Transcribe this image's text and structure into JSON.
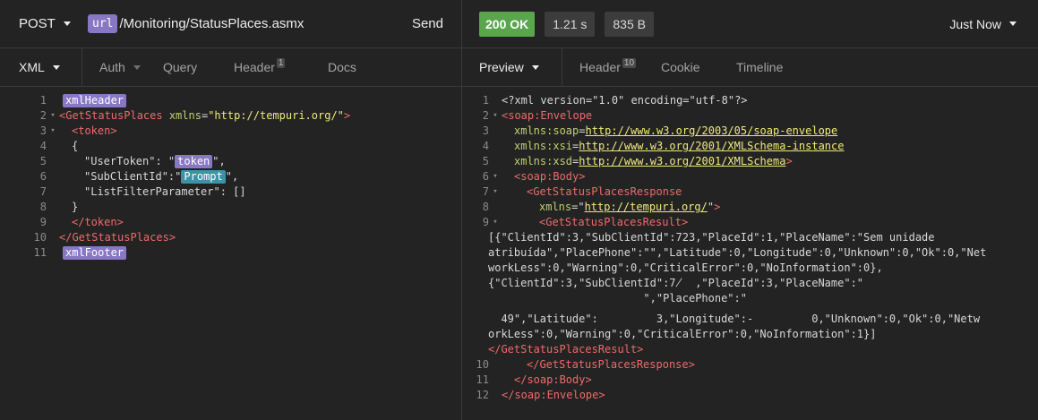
{
  "request": {
    "method": "POST",
    "url_tag": "url",
    "url_path": "/Monitoring/StatusPlaces.asmx",
    "send_label": "Send",
    "tabs": [
      {
        "label": "XML",
        "badge": ""
      },
      {
        "label": "Auth",
        "badge": ""
      },
      {
        "label": "Query",
        "badge": ""
      },
      {
        "label": "Header",
        "badge": "1"
      },
      {
        "label": "Docs",
        "badge": ""
      }
    ],
    "body_lines": {
      "l1_tag": "xmlHeader",
      "l2_open": "<GetStatusPlaces",
      "l2_attr": "xmlns",
      "l2_eq": "=",
      "l2_val": "\"http://tempuri.org/\"",
      "l2_close": ">",
      "l3": "<token>",
      "l4": "{",
      "l5_pre": "\"UserToken\": \"",
      "l5_tag": "token",
      "l5_post": "\",",
      "l6_pre": "\"SubClientId\":\"",
      "l6_tag": "Prompt",
      "l6_post": "\",",
      "l7": "\"ListFilterParameter\": []",
      "l8": "}",
      "l9": "</token>",
      "l10": "</GetStatusPlaces>",
      "l11_tag": "xmlFooter"
    }
  },
  "response": {
    "status": "200 OK",
    "time": "1.21 s",
    "size": "835 B",
    "history_label": "Just Now",
    "tabs": [
      {
        "label": "Preview",
        "badge": ""
      },
      {
        "label": "Header",
        "badge": "10"
      },
      {
        "label": "Cookie",
        "badge": ""
      },
      {
        "label": "Timeline",
        "badge": ""
      }
    ],
    "body": {
      "l1": "<?xml version=\"1.0\" encoding=\"utf-8\"?>",
      "l2": "<soap:Envelope",
      "l3_attr": "xmlns:soap",
      "l3_val": "http://www.w3.org/2003/05/soap-envelope",
      "l4_attr": "xmlns:xsi",
      "l4_val": "http://www.w3.org/2001/XMLSchema-instance",
      "l5_attr": "xmlns:xsd",
      "l5_val": "http://www.w3.org/2001/XMLSchema",
      "l6": "<soap:Body>",
      "l7": "<GetStatusPlacesResponse",
      "l8_attr": "xmlns",
      "l8_val": "http://tempuri.org/",
      "l9": "<GetStatusPlacesResult>",
      "w1": "[{\"ClientId\":3,\"SubClientId\":723,\"PlaceId\":1,\"PlaceName\":\"Sem unidade",
      "w2": "atribuída\",\"PlacePhone\":\"\",\"Latitude\":0,\"Longitude\":0,\"Unknown\":0,\"Ok\":0,\"Net",
      "w3": "workLess\":0,\"Warning\":0,\"CriticalError\":0,\"NoInformation\":0},",
      "w4": "{\"ClientId\":3,\"SubClientId\":7̸  ,\"PlaceId\":3,\"PlaceName\":\"",
      "w5": "                        \",\"PlacePhone\":\"",
      "w6": "  49\",\"Latitude\":         3,\"Longitude\":-         0,\"Unknown\":0,\"Ok\":0,\"Netw",
      "w7": "orkLess\":0,\"Warning\":0,\"CriticalError\":0,\"NoInformation\":1}]",
      "w8": "</GetStatusPlacesResult>",
      "l10": "</GetStatusPlacesResponse>",
      "l11": "</soap:Body>",
      "l12": "</soap:Envelope>"
    }
  }
}
